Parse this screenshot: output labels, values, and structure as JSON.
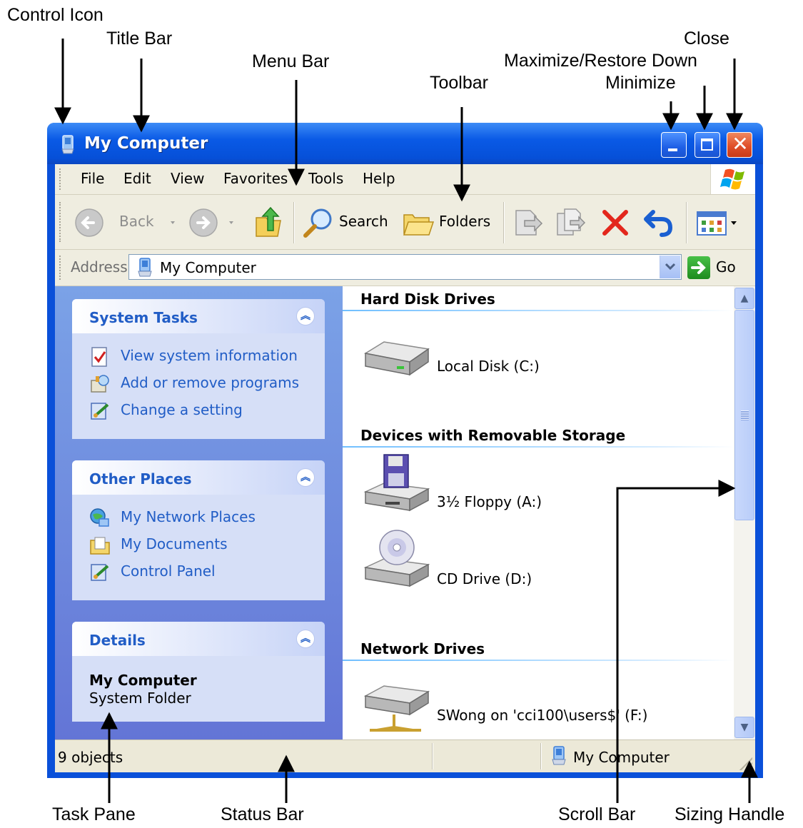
{
  "callouts": {
    "control_icon": "Control Icon",
    "title_bar": "Title Bar",
    "menu_bar": "Menu Bar",
    "toolbar": "Toolbar",
    "maximize_restore": "Maximize/Restore Down",
    "minimize": "Minimize",
    "close": "Close",
    "task_pane": "Task Pane",
    "status_bar": "Status Bar",
    "scroll_bar": "Scroll Bar",
    "sizing_handle": "Sizing Handle"
  },
  "window": {
    "title": "My Computer",
    "title_icon": "my-computer-icon"
  },
  "menu": [
    "File",
    "Edit",
    "View",
    "Favorites",
    "Tools",
    "Help"
  ],
  "toolbar": {
    "back": "Back",
    "search": "Search",
    "folders": "Folders",
    "icons": [
      "back-icon",
      "forward-icon",
      "up-folder-icon",
      "search-icon",
      "folders-icon",
      "move-to-icon",
      "copy-to-icon",
      "delete-icon",
      "undo-icon",
      "views-icon"
    ]
  },
  "address": {
    "label": "Address",
    "value": "My Computer",
    "go": "Go"
  },
  "task_pane": {
    "system_tasks": {
      "title": "System Tasks",
      "items": [
        "View system information",
        "Add or remove programs",
        "Change a setting"
      ]
    },
    "other_places": {
      "title": "Other Places",
      "items": [
        "My Network Places",
        "My Documents",
        "Control Panel"
      ]
    },
    "details": {
      "title": "Details",
      "name": "My Computer",
      "type": "System Folder"
    }
  },
  "groups": {
    "hard_disks": {
      "title": "Hard Disk Drives",
      "items": [
        "Local Disk (C:)"
      ]
    },
    "removable": {
      "title": "Devices with Removable Storage",
      "items": [
        "3½ Floppy (A:)",
        "CD Drive (D:)"
      ]
    },
    "network": {
      "title": "Network Drives",
      "items": [
        "SWong on 'cci100\\users$' (F:)"
      ]
    }
  },
  "status": {
    "objects": "9 objects",
    "location": "My Computer"
  },
  "colors": {
    "title_bar": "#0a5ae6",
    "task_pane": "#6f8ddf",
    "link": "#215dc6",
    "close_button": "#e0502a"
  }
}
